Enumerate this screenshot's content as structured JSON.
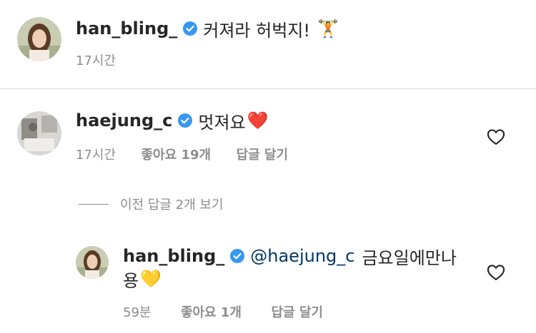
{
  "comments": [
    {
      "username": "han_bling_",
      "text": "커져라 허벅지!",
      "emoji": "🏋️",
      "time": "17시간"
    },
    {
      "username": "haejung_c",
      "text": "멋져요",
      "emoji": "❤️",
      "time": "17시간",
      "likes": "좋아요 19개",
      "reply": "답글 달기"
    }
  ],
  "view_replies": "이전 답글 2개 보기",
  "reply": {
    "username": "han_bling_",
    "mention": "@haejung_c",
    "text_line1": "금요일에만나",
    "text_line2": "용",
    "emoji": "💛",
    "time": "59분",
    "likes": "좋아요 1개",
    "reply": "답글 달기"
  },
  "colors": {
    "verified": "#3897f0",
    "mention": "#00376b",
    "meta": "#8e8e8e"
  }
}
